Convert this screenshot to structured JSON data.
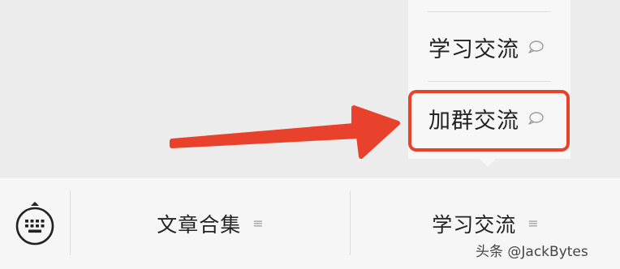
{
  "submenu": {
    "items": [
      {
        "label": "学习交流",
        "icon": "chat-bubble-icon"
      },
      {
        "label": "加群交流",
        "icon": "chat-bubble-icon"
      }
    ]
  },
  "menu_bar": {
    "keyboard_icon": "keyboard-icon",
    "tabs": [
      {
        "label": "文章合集",
        "icon": "menu-lines-icon",
        "glyph": "≡"
      },
      {
        "label": "学习交流",
        "icon": "menu-lines-icon",
        "glyph": "≡"
      }
    ]
  },
  "annotation": {
    "arrow_color": "#e8422c",
    "highlight_color": "#e8422c"
  },
  "watermark": "头条 @JackBytes"
}
